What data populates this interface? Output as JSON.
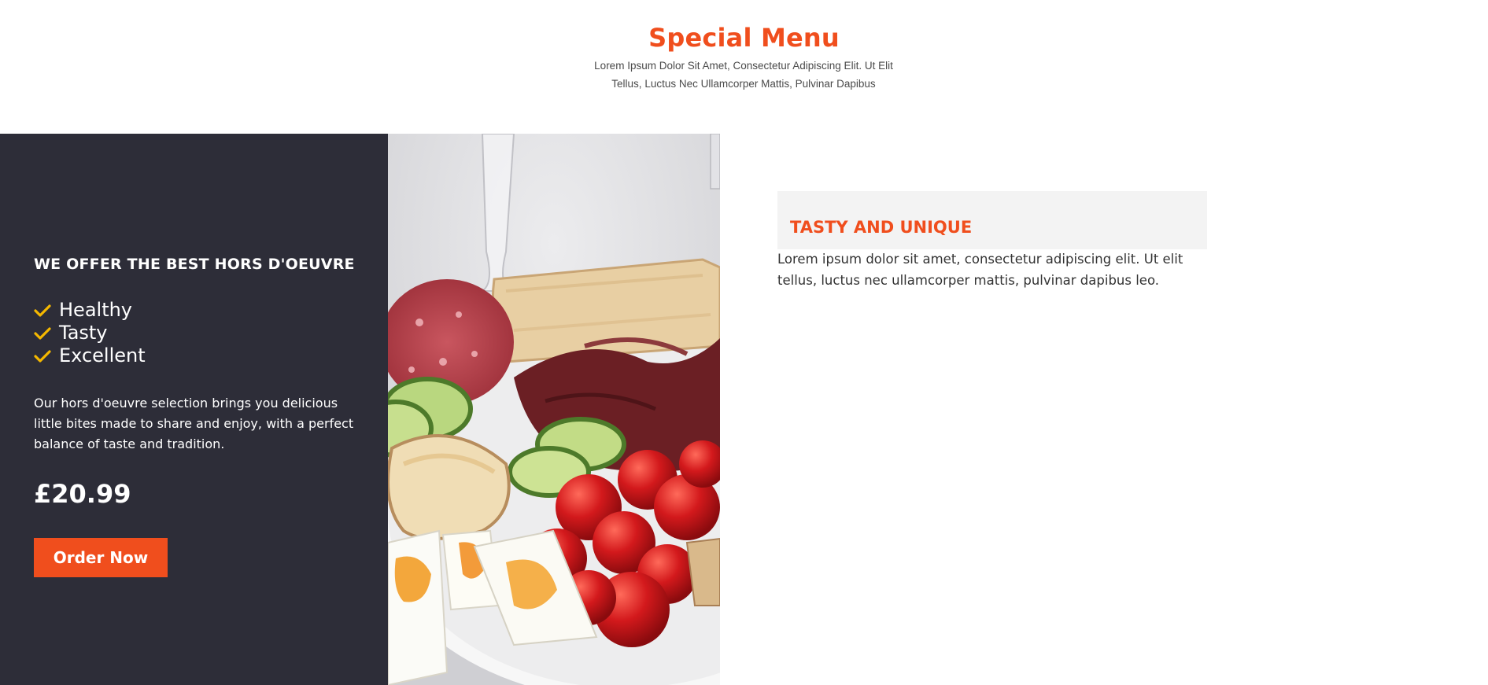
{
  "header": {
    "title": "Special Menu",
    "subtitle": "Lorem Ipsum Dolor Sit Amet, Consectetur Adipiscing Elit. Ut Elit Tellus, Luctus Nec Ullamcorper Mattis, Pulvinar Dapibus"
  },
  "offer": {
    "title": "WE OFFER THE BEST HORS D'OEUVRE",
    "features": [
      {
        "icon": "check-icon",
        "label": "Healthy"
      },
      {
        "icon": "check-icon",
        "label": "Tasty"
      },
      {
        "icon": "check-icon",
        "label": "Excellent"
      }
    ],
    "description": "Our hors d'oeuvre selection brings you delicious little bites made to share and enjoy, with a perfect balance of taste and tradition.",
    "price": "£20.99",
    "order_label": "Order Now"
  },
  "info": {
    "title": "TASTY AND UNIQUE",
    "text": "Lorem ipsum dolor sit amet, consectetur adipiscing elit. Ut elit tellus, luctus nec ullamcorper mattis, pulvinar dapibus leo."
  },
  "colors": {
    "accent": "#f04e1d",
    "panel": "#2d2d38",
    "check": "#f5b800",
    "info_box": "#f3f3f3"
  }
}
